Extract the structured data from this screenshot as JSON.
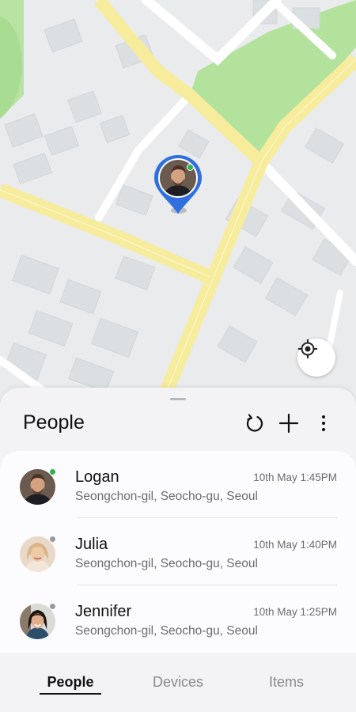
{
  "map": {
    "pin_person": "Logan",
    "pin_status_color": "#2fb24a",
    "pin_ring_color": "#2f6fde"
  },
  "sheet": {
    "title": "People",
    "actions": [
      "refresh-icon",
      "add-icon",
      "more-vert-icon"
    ]
  },
  "people": [
    {
      "name": "Logan",
      "address": "Seongchon-gil, Seocho-gu, Seoul",
      "time": "10th May 1:45PM",
      "status_color": "#2fb24a"
    },
    {
      "name": "Julia",
      "address": "Seongchon-gil, Seocho-gu, Seoul",
      "time": "10th May 1:40PM",
      "status_color": "#9a9a9e"
    },
    {
      "name": "Jennifer",
      "address": "Seongchon-gil, Seocho-gu, Seoul",
      "time": "10th May 1:25PM",
      "status_color": "#9a9a9e"
    }
  ],
  "tabs": {
    "people": "People",
    "devices": "Devices",
    "items": "Items",
    "active": "People"
  }
}
